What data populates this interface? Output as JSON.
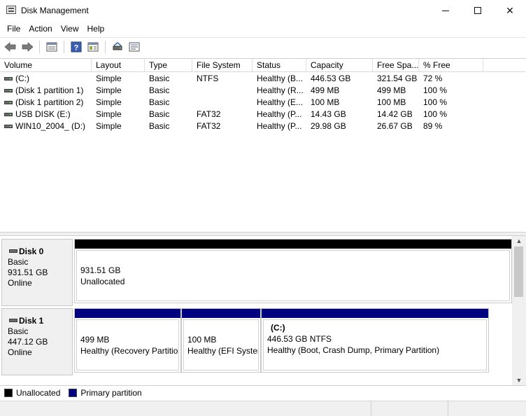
{
  "window": {
    "title": "Disk Management"
  },
  "menu": [
    "File",
    "Action",
    "View",
    "Help"
  ],
  "toolbar": {
    "buttons": [
      "back-icon",
      "forward-icon",
      "properties-list-icon",
      "help-icon",
      "snapin-icon",
      "rescan-disks-icon",
      "settings-icon"
    ]
  },
  "volumes": {
    "columns": [
      "Volume",
      "Layout",
      "Type",
      "File System",
      "Status",
      "Capacity",
      "Free Spa...",
      "% Free"
    ],
    "rows": [
      [
        "(C:)",
        "Simple",
        "Basic",
        "NTFS",
        "Healthy (B...",
        "446.53 GB",
        "321.54 GB",
        "72 %"
      ],
      [
        "(Disk 1 partition 1)",
        "Simple",
        "Basic",
        "",
        "Healthy (R...",
        "499 MB",
        "499 MB",
        "100 %"
      ],
      [
        "(Disk 1 partition 2)",
        "Simple",
        "Basic",
        "",
        "Healthy (E...",
        "100 MB",
        "100 MB",
        "100 %"
      ],
      [
        "USB DISK (E:)",
        "Simple",
        "Basic",
        "FAT32",
        "Healthy (P...",
        "14.43 GB",
        "14.42 GB",
        "100 %"
      ],
      [
        "WIN10_2004_ (D:)",
        "Simple",
        "Basic",
        "FAT32",
        "Healthy (P...",
        "29.98 GB",
        "26.67 GB",
        "89 %"
      ]
    ]
  },
  "disks": [
    {
      "name": "Disk 0",
      "type": "Basic",
      "size": "931.51 GB",
      "state": "Online",
      "partitions": [
        {
          "title": "",
          "line1": "931.51 GB",
          "line2": "Unallocated",
          "kind": "unallocated"
        }
      ]
    },
    {
      "name": "Disk 1",
      "type": "Basic",
      "size": "447.12 GB",
      "state": "Online",
      "partitions": [
        {
          "title": "",
          "line1": "499 MB",
          "line2": "Healthy (Recovery Partitio",
          "kind": "primary"
        },
        {
          "title": "",
          "line1": "100 MB",
          "line2": "Healthy (EFI Syster",
          "kind": "primary"
        },
        {
          "title": "(C:)",
          "line1": "446.53 GB NTFS",
          "line2": "Healthy (Boot, Crash Dump, Primary Partition)",
          "kind": "primary"
        }
      ]
    }
  ],
  "legend": [
    {
      "label": "Unallocated",
      "color": "#000000"
    },
    {
      "label": "Primary partition",
      "color": "#000080"
    }
  ],
  "colors": {
    "unallocated": "#000000",
    "primary": "#000080"
  }
}
